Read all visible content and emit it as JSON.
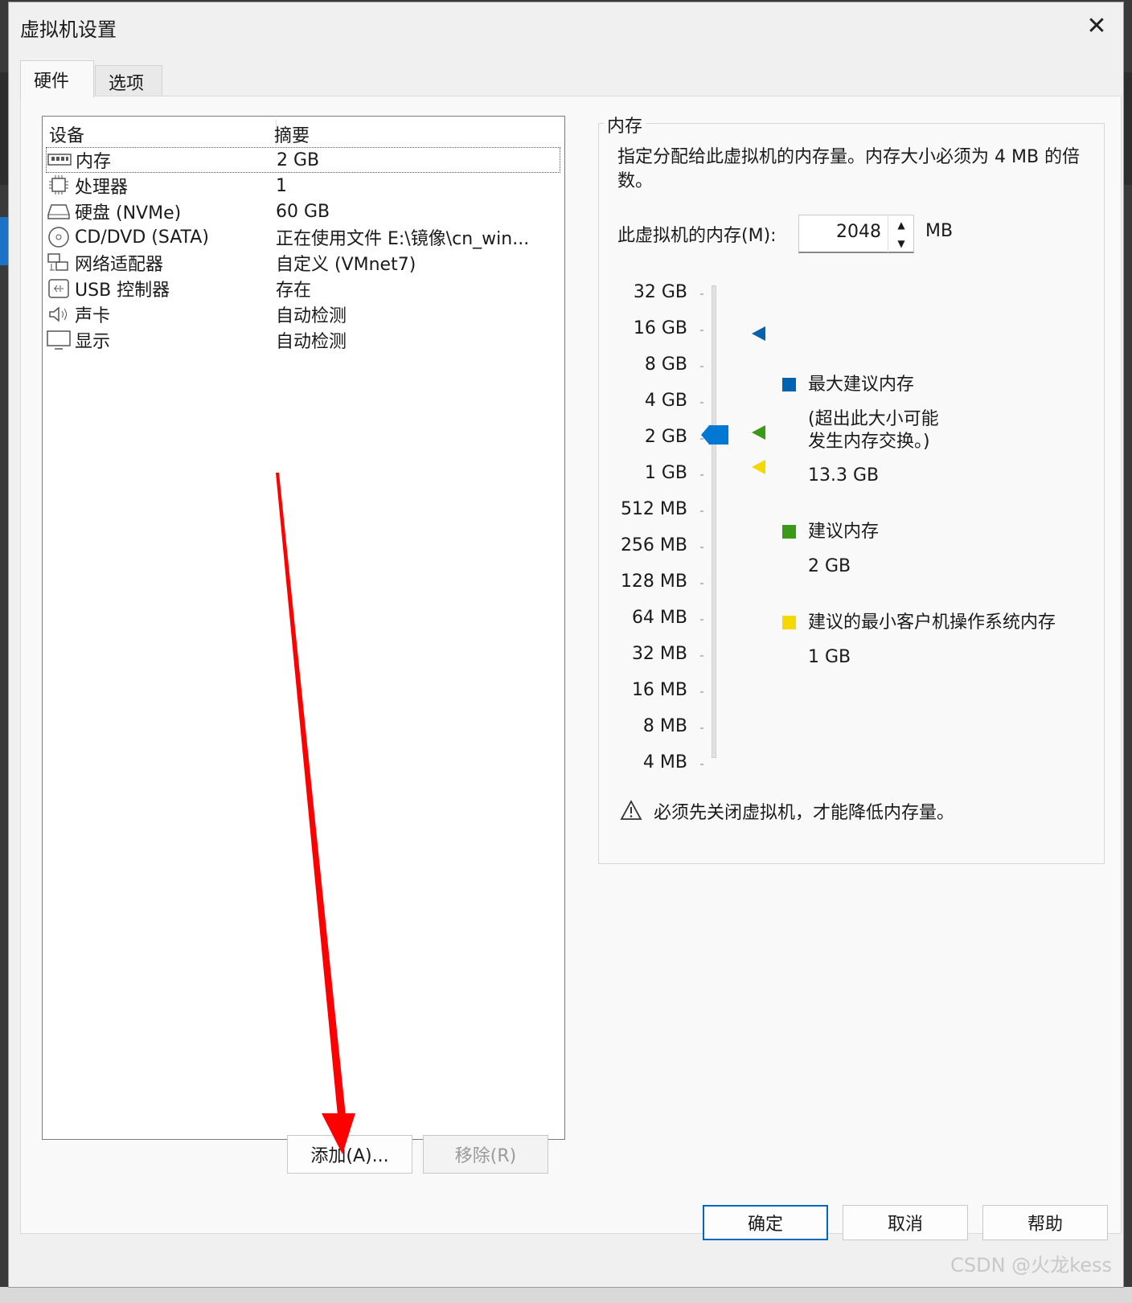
{
  "window": {
    "title": "虚拟机设置",
    "close_label": "✕"
  },
  "tabs": [
    {
      "label": "硬件"
    },
    {
      "label": "选项"
    }
  ],
  "device_list": {
    "headers": {
      "device": "设备",
      "summary": "摘要"
    },
    "rows": [
      {
        "name": "内存",
        "summary": "2 GB",
        "icon": "memory-icon"
      },
      {
        "name": "处理器",
        "summary": "1",
        "icon": "processor-icon"
      },
      {
        "name": "硬盘 (NVMe)",
        "summary": "60 GB",
        "icon": "hard-disk-icon"
      },
      {
        "name": "CD/DVD (SATA)",
        "summary": "正在使用文件 E:\\镜像\\cn_win...",
        "icon": "cd-dvd-icon"
      },
      {
        "name": "网络适配器",
        "summary": "自定义 (VMnet7)",
        "icon": "network-adapter-icon"
      },
      {
        "name": "USB 控制器",
        "summary": "存在",
        "icon": "usb-icon"
      },
      {
        "name": "声卡",
        "summary": "自动检测",
        "icon": "sound-card-icon"
      },
      {
        "name": "显示",
        "summary": "自动检测",
        "icon": "display-icon"
      }
    ]
  },
  "list_buttons": {
    "add": "添加(A)...",
    "remove": "移除(R)"
  },
  "memory": {
    "group_title": "内存",
    "description": "指定分配给此虚拟机的内存量。内存大小必须为 4 MB 的倍数。",
    "field_label": "此虚拟机的内存(M):",
    "value": "2048",
    "unit": "MB",
    "scale": [
      "32 GB",
      "16 GB",
      "8 GB",
      "4 GB",
      "2 GB",
      "1 GB",
      "512 MB",
      "256 MB",
      "128 MB",
      "64 MB",
      "32 MB",
      "16 MB",
      "8 MB",
      "4 MB"
    ],
    "legend": {
      "max": {
        "title": "最大建议内存",
        "note_line1": "(超出此大小可能",
        "note_line2": "发生内存交换。)",
        "value": "13.3 GB",
        "color": "#0063b1"
      },
      "recommended": {
        "title": "建议内存",
        "value": "2 GB",
        "color": "#3a9a17"
      },
      "min": {
        "title": "建议的最小客户机操作系统内存",
        "value": "1 GB",
        "color": "#f5d800"
      }
    },
    "warning": "必须先关闭虚拟机，才能降低内存量。"
  },
  "footer": {
    "ok": "确定",
    "cancel": "取消",
    "help": "帮助"
  },
  "watermark": "CSDN @火龙kess"
}
